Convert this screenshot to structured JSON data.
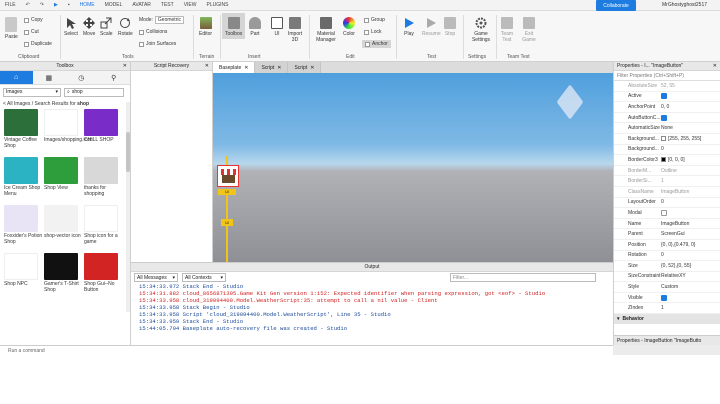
{
  "menubar": {
    "items": [
      "FILE",
      "HOME",
      "MODEL",
      "AVATAR",
      "TEST",
      "VIEW",
      "PLUGINS"
    ],
    "collaborate": "Collaborate",
    "username": "MrGhostyghost2517"
  },
  "ribbon": {
    "clipboard": {
      "paste": "Paste",
      "copy": "Copy",
      "cut": "Cut",
      "duplicate": "Duplicate",
      "group": "Clipboard"
    },
    "tools": {
      "select": "Select",
      "move": "Move",
      "scale": "Scale",
      "rotate": "Rotate",
      "group": "Tools"
    },
    "mode": {
      "label": "Mode:",
      "value": "Geometric",
      "collisions": "Collisions",
      "join": "Join Surfaces"
    },
    "terrain": {
      "editor": "Editor",
      "group": "Terrain"
    },
    "insert": {
      "toolbox": "Toolbox",
      "part": "Part",
      "ui": "UI",
      "import3d": "Import 3D",
      "group": "Insert"
    },
    "edit": {
      "material": "Material Manager",
      "color": "Color",
      "group_btn": "Group",
      "lock": "Lock",
      "anchor": "Anchor",
      "group": "Edit"
    },
    "test": {
      "play": "Play",
      "resume": "Resume",
      "stop": "Stop",
      "group": "Test"
    },
    "settings": {
      "game": "Game Settings",
      "group": "Settings"
    },
    "team": {
      "test": "Team Test",
      "exit": "Exit Game",
      "group": "Team Test"
    }
  },
  "toolbox": {
    "title": "Toolbox",
    "category": "Images",
    "search": "shop",
    "results": "< All Images / Search Results for",
    "results_term": "shop",
    "items": [
      {
        "caption": "Vintage Coffee Shop",
        "color": "#2c6f3a"
      },
      {
        "caption": "Images/shopping.icon",
        "color": "#ffffff"
      },
      {
        "caption": "CHILL SHOP",
        "color": "#7a2cc9"
      },
      {
        "caption": "Ice Cream Shop Menu",
        "color": "#2bb3c4"
      },
      {
        "caption": "Shop View",
        "color": "#2e9e3c"
      },
      {
        "caption": "thanks for shopping",
        "color": "#d8d8d8"
      },
      {
        "caption": "Foxxider's Potion Shop",
        "color": "#e9e4f5"
      },
      {
        "caption": "shop-vector icon",
        "color": "#f2f2f2"
      },
      {
        "caption": "Shop icon for a game",
        "color": "#ffffff"
      },
      {
        "caption": "Shop NPC",
        "color": "#ffffff"
      },
      {
        "caption": "Gamer's T-Shirt Shop",
        "color": "#111111"
      },
      {
        "caption": "Shop Gui--No Button",
        "color": "#d32424"
      }
    ]
  },
  "scriptrec": {
    "title": "Script Recovery"
  },
  "tabs": [
    {
      "label": "Baseplate",
      "selected": true
    },
    {
      "label": "Script",
      "selected": false
    },
    {
      "label": "Script",
      "selected": false
    }
  ],
  "viewport": {
    "label1": "Ui",
    "label2": "Ui",
    "label3": "Ui"
  },
  "output": {
    "title": "Output",
    "filter_messages": "All Messages",
    "filter_contexts": "All Contexts",
    "filter_placeholder": "Filter...",
    "lines": [
      {
        "text": "15:34:33.972  Stack End  -  Studio",
        "color": "#1a4a9a"
      },
      {
        "text": "15:34:31.882  cloud_8656871395.Game Kit Gen version 1:152: Expected identifier when parsing expression, got <eof>  -  Studio",
        "color": "#d22020"
      },
      {
        "text": "15:34:33.958  cloud_319094400.Model.WeatherScript:35: attempt to call a nil value  -  Client",
        "color": "#d22020"
      },
      {
        "text": "15:34:33.958  Stack Begin  -  Studio",
        "color": "#1a4a9a"
      },
      {
        "text": "15:34:33.958  Script 'cloud_319094400.Model.WeatherScript', Line 35  -  Studio",
        "color": "#1a4a9a"
      },
      {
        "text": "15:34:33.959  Stack End  -  Studio",
        "color": "#1a4a9a"
      },
      {
        "text": "15:44:05.704  Baseplate auto-recovery file was created  -  Studio",
        "color": "#1a4a9a"
      }
    ]
  },
  "properties": {
    "title": "Properties - I... \"ImageButton\"",
    "filter": "Filter Properties (Ctrl+Shift+P)",
    "rows": [
      {
        "name": "AbsoluteSize",
        "value": "52, 55",
        "muted": true
      },
      {
        "name": "Active",
        "value": "",
        "check": true
      },
      {
        "name": "AnchorPoint",
        "value": "0, 0"
      },
      {
        "name": "AutoButtonC...",
        "value": "",
        "check": true
      },
      {
        "name": "AutomaticSize",
        "value": "None"
      },
      {
        "name": "Background...",
        "value": "[255, 255, 255]",
        "swatch": "#ffffff"
      },
      {
        "name": "Background...",
        "value": "0"
      },
      {
        "name": "BorderColor3",
        "value": "[0, 0, 0]",
        "swatch": "#000000"
      },
      {
        "name": "BorderM...",
        "value": "Outline",
        "muted": true
      },
      {
        "name": "BorderSi...",
        "value": "1",
        "muted": true
      },
      {
        "name": "ClassName",
        "value": "ImageButton",
        "muted": true
      },
      {
        "name": "LayoutOrder",
        "value": "0"
      },
      {
        "name": "Modal",
        "value": "",
        "check": false
      },
      {
        "name": "Name",
        "value": "ImageButton"
      },
      {
        "name": "Parent",
        "value": "ScreenGui"
      },
      {
        "name": "Position",
        "value": "{0, 0},{0.479, 0}"
      },
      {
        "name": "Rotation",
        "value": "0"
      },
      {
        "name": "Size",
        "value": "{0, 52},{0, 55}"
      },
      {
        "name": "SizeConstraint",
        "value": "RelativeXY"
      },
      {
        "name": "Style",
        "value": "Custom"
      },
      {
        "name": "Visible",
        "value": "",
        "check": true
      },
      {
        "name": "ZIndex",
        "value": "1"
      }
    ],
    "section": "Behavior",
    "footer": "Properties - ImageButton \"ImageButto"
  },
  "command": {
    "placeholder": "Run a command"
  }
}
